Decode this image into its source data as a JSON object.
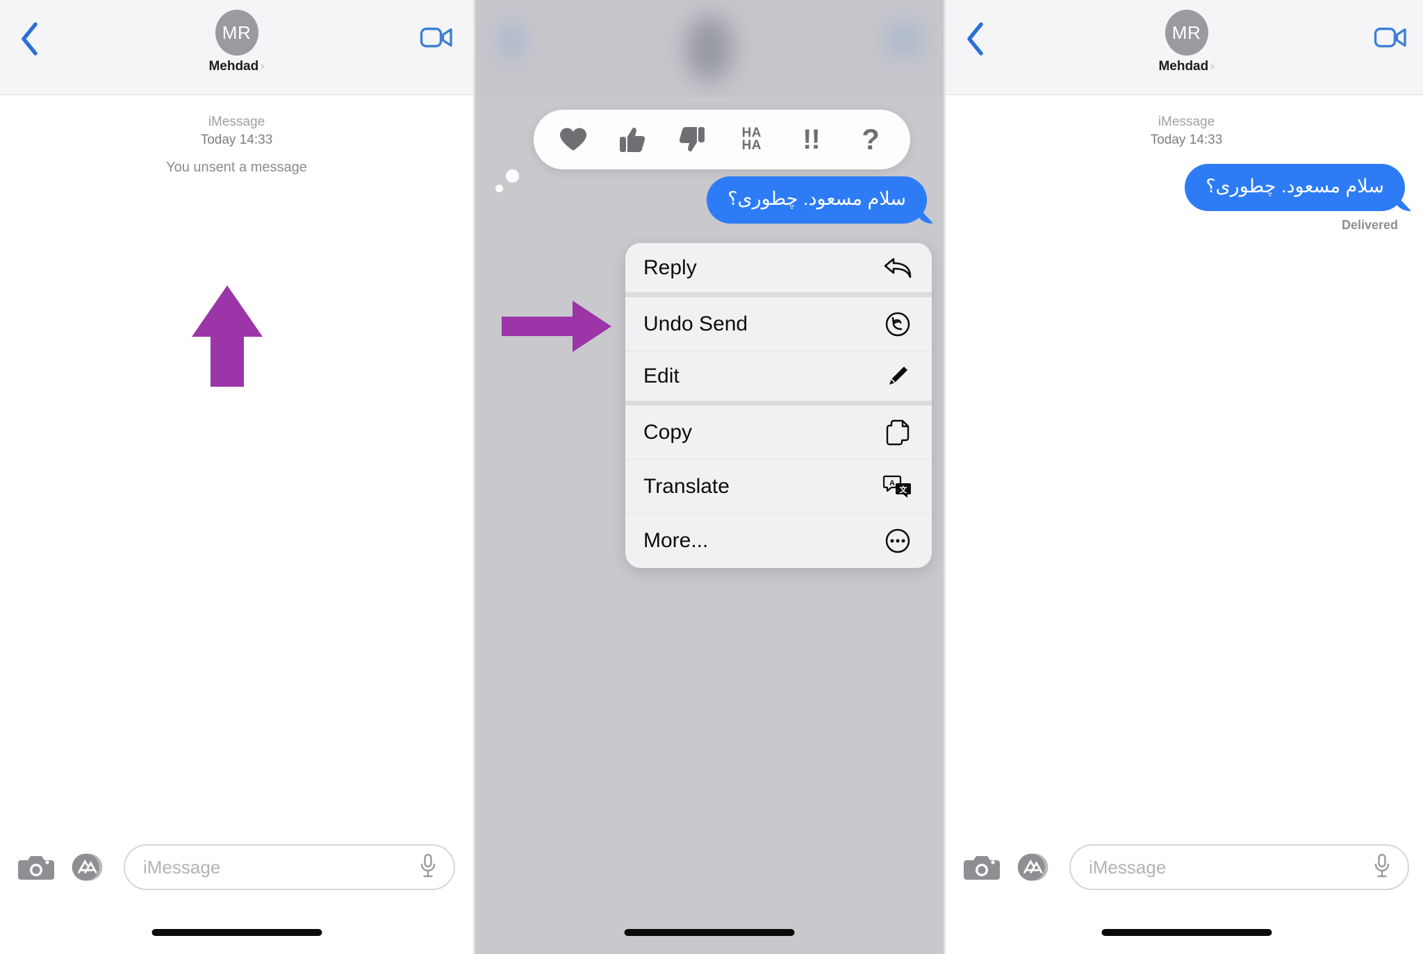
{
  "app": {
    "name": "Messages",
    "accent_blue": "#2d7cf6",
    "arrow_purple": "#9b35a8",
    "nav_bg": "#f5f5f7",
    "overlay_gray": "#c8c8cd",
    "menu_bg": "#f1f1f3"
  },
  "navbar": {
    "back_icon": "chevron-left-icon",
    "avatar_initials": "MR",
    "contact_name": "Mehdad",
    "contact_chevron": "›",
    "video_icon": "video-camera-icon"
  },
  "conversation": {
    "service_label": "iMessage",
    "timestamp": "Today 14:33",
    "unsent_note": "You unsent a message",
    "message_text": "سلام مسعود. چطوری؟",
    "delivered_label": "Delivered"
  },
  "input_bar": {
    "camera_icon": "camera-icon",
    "apps_icon": "app-store-icon",
    "placeholder": "iMessage",
    "mic_icon": "microphone-icon"
  },
  "reaction_bar": {
    "items": [
      {
        "name": "heart-reaction",
        "glyph": "♥",
        "label": "Love"
      },
      {
        "name": "thumbs-up-reaction",
        "glyph": "👍",
        "label": "Like"
      },
      {
        "name": "thumbs-down-reaction",
        "glyph": "👎",
        "label": "Dislike"
      },
      {
        "name": "haha-reaction",
        "line1": "HA",
        "line2": "HA",
        "label": "Haha"
      },
      {
        "name": "exclamation-reaction",
        "glyph": "!!",
        "label": "Emphasize"
      },
      {
        "name": "question-reaction",
        "glyph": "?",
        "label": "Question"
      }
    ]
  },
  "context_menu": {
    "items": [
      {
        "label": "Reply",
        "icon": "reply-arrow-icon"
      },
      {
        "label": "Undo Send",
        "icon": "undo-circle-icon"
      },
      {
        "label": "Edit",
        "icon": "pencil-icon"
      },
      {
        "label": "Copy",
        "icon": "copy-documents-icon"
      },
      {
        "label": "Translate",
        "icon": "translate-icon"
      },
      {
        "label": "More...",
        "icon": "ellipsis-circle-icon"
      }
    ]
  },
  "annotations": {
    "arrow_up_target": "You unsent a message",
    "arrow_right_target": "Undo Send"
  }
}
